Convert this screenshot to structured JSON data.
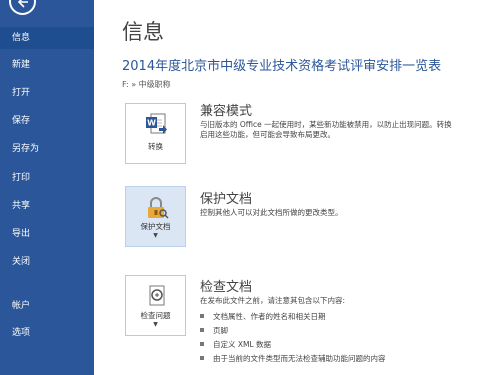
{
  "sidebar": {
    "items": [
      {
        "label": "信息"
      },
      {
        "label": "新建"
      },
      {
        "label": "打开"
      },
      {
        "label": "保存"
      },
      {
        "label": "另存为"
      },
      {
        "label": "打印"
      },
      {
        "label": "共享"
      },
      {
        "label": "导出"
      },
      {
        "label": "关闭"
      },
      {
        "label": "帐户"
      },
      {
        "label": "选项"
      }
    ]
  },
  "main": {
    "page_title": "信息",
    "doc_title": "2014年度北京市中级专业技术资格考试评审安排一览表",
    "path": "F: » 中级职称",
    "sections": [
      {
        "button_label": "转换",
        "heading": "兼容模式",
        "desc_line1": "与旧版本的 Office 一起使用时，某些新功能被禁用，以防止出现问题。转换",
        "desc_line2": "启用这些功能，但可能会导致布局更改。"
      },
      {
        "button_label": "保护文档",
        "heading": "保护文档",
        "desc_line1": "控制其他人可以对此文档所做的更改类型。"
      },
      {
        "button_label": "检查问题",
        "heading": "检查文档",
        "desc_line1": "在发布此文件之前，请注意其包含以下内容:",
        "bullets": [
          "文档属性、作者的姓名和相关日期",
          "页脚",
          "自定义 XML 数据",
          "由于当前的文件类型而无法检查辅助功能问题的内容"
        ]
      }
    ]
  },
  "colors": {
    "sidebar": "#2b579a",
    "selected": "#dbe6f4",
    "title_blue": "#2b579a"
  }
}
